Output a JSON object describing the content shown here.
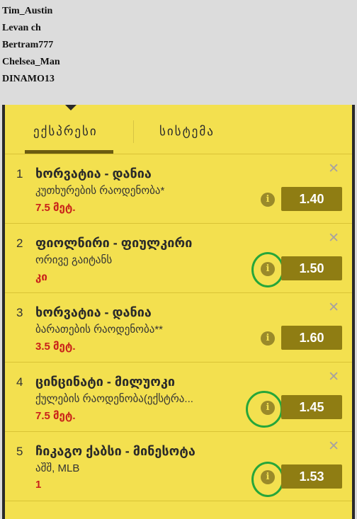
{
  "users": [
    "Tim_Austin",
    "Levan ch",
    "Bertram777",
    "Chelsea_Man",
    "DINAMO13"
  ],
  "tabs": [
    {
      "label": "ექსპრესი",
      "active": true
    },
    {
      "label": "სისტემა",
      "active": false
    }
  ],
  "bets": [
    {
      "index": "1",
      "match": "ხორვატია - დანია",
      "market": "კუთხურების რაოდენობა*",
      "selection": "7.5 მეტ.",
      "odds": "1.40"
    },
    {
      "index": "2",
      "match": "ფიოლნირი - ფიულკირი",
      "market": "ორივე გაიტანს",
      "selection": "კი",
      "odds": "1.50"
    },
    {
      "index": "3",
      "match": "ხორვატია - დანია",
      "market": "ბარათების რაოდენობა**",
      "selection": "3.5 მეტ.",
      "odds": "1.60"
    },
    {
      "index": "4",
      "match": "ცინცინატი - მილუოკი",
      "market": "ქულების რაოდენობა(ექსტრა...",
      "selection": "7.5 მეტ.",
      "odds": "1.45"
    },
    {
      "index": "5",
      "match": "ჩიკაგო ქაბსი - მინესოტა",
      "market": "აშშ, MLB",
      "selection": "1",
      "odds": "1.53"
    }
  ],
  "icons": {
    "info": "info-icon",
    "close": "close-icon"
  },
  "colors": {
    "panel": "#f3e04f",
    "odds_bg": "#8f7d13",
    "selection": "#c9221a",
    "highlight_circle": "#26a63a"
  }
}
